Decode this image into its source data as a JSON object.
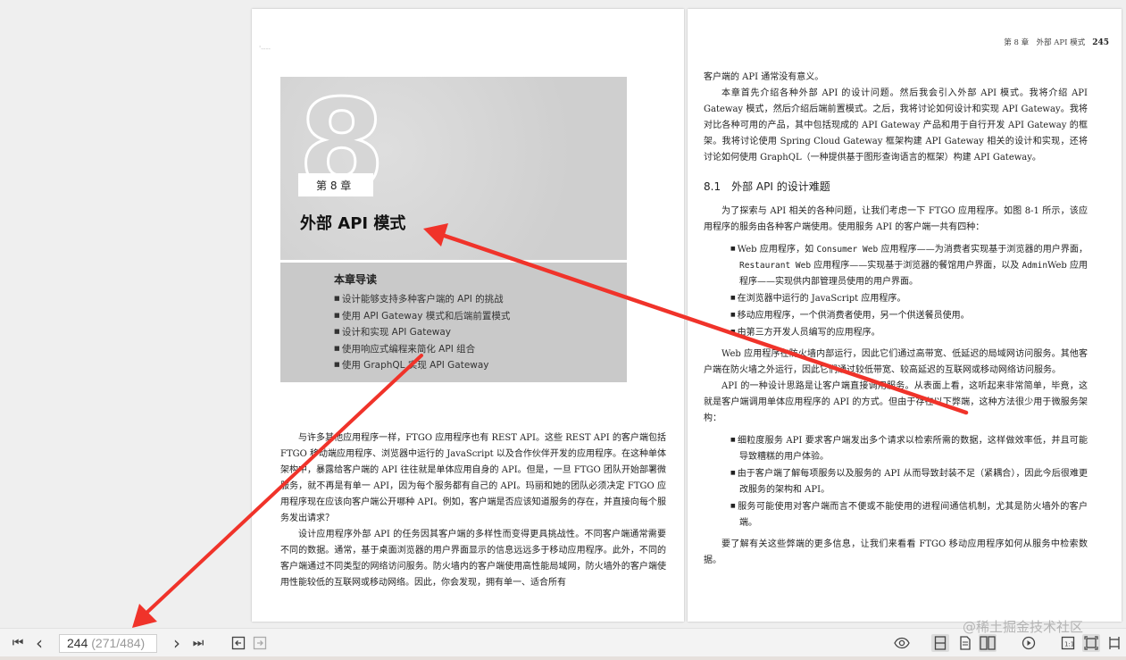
{
  "left_page": {
    "ghost_mark": "'----",
    "chapter_number": "8",
    "chapter_label": "第 8 章",
    "chapter_title": "外部 API 模式",
    "guide": {
      "title": "本章导读",
      "items": [
        "设计能够支持多种客户端的 API 的挑战",
        "使用 API Gateway 模式和后端前置模式",
        "设计和实现 API Gateway",
        "使用响应式编程来简化 API 组合",
        "使用 GraphQL 实现 API Gateway"
      ]
    },
    "paragraphs": [
      "与许多其他应用程序一样，FTGO 应用程序也有 REST API。这些 REST API 的客户端包括 FTGO 移动端应用程序、浏览器中运行的 JavaScript 以及合作伙伴开发的应用程序。在这种单体架构中，暴露给客户端的 API 往往就是单体应用自身的 API。但是，一旦 FTGO 团队开始部署微服务，就不再是有单一 API，因为每个服务都有自己的 API。玛丽和她的团队必须决定 FTGO 应用程序现在应该向客户端公开哪种 API。例如，客户端是否应该知道服务的存在，并直接向每个服务发出请求？",
      "设计应用程序外部 API 的任务因其客户端的多样性而变得更具挑战性。不同客户端通常需要不同的数据。通常，基于桌面浏览器的用户界面显示的信息远远多于移动应用程序。此外，不同的客户端通过不同类型的网络访问服务。防火墙内的客户端使用高性能局域网，防火墙外的客户端使用性能较低的互联网或移动网络。因此，你会发现，拥有单一、适合所有"
    ]
  },
  "right_page": {
    "running_head": "第 8 章　外部 API 模式",
    "page_number": "245",
    "intro": [
      "客户端的 API 通常没有意义。",
      "本章首先介绍各种外部 API 的设计问题。然后我会引入外部 API 模式。我将介绍 API Gateway 模式，然后介绍后端前置模式。之后，我将讨论如何设计和实现 API Gateway。我将对比各种可用的产品，其中包括现成的 API Gateway 产品和用于自行开发 API Gateway 的框架。我将讨论使用 Spring Cloud Gateway 框架构建 API Gateway 相关的设计和实现，还将讨论如何使用 GraphQL（一种提供基于图形查询语言的框架）构建 API Gateway。"
    ],
    "section_title": "8.1　外部 API 的设计难题",
    "section_intro": "为了探索与 API 相关的各种问题，让我们考虑一下 FTGO 应用程序。如图 8-1 所示，该应用程序的服务由各种客户端使用。使用服务 API 的客户端一共有四种：",
    "clients": {
      "web_a": "Web 应用程序，如 ",
      "consumer_web": "Consumer Web",
      "web_b": " 应用程序——为消费者实现基于浏览器的用户界面，",
      "restaurant_web": "Restaurant Web",
      "web_c": " 应用程序——实现基于浏览器的餐馆用户界面，以及 ",
      "admin": "Admin",
      "web_d": "Web 应用程序——实现供内部管理员使用的用户界面。",
      "js": "在浏览器中运行的 JavaScript 应用程序。",
      "mobile": "移动应用程序，一个供消费者使用，另一个供送餐员使用。",
      "third_party": "由第三方开发人员编写的应用程序。"
    },
    "para_firewall": "Web 应用程序在防火墙内部运行，因此它们通过高带宽、低延迟的局域网访问服务。其他客户端在防火墙之外运行，因此它们通过较低带宽、较高延迟的互联网或移动网络访问服务。",
    "para_design": "API 的一种设计思路是让客户端直接调用服务。从表面上看，这听起来非常简单，毕竟，这就是客户端调用单体应用程序的 API 的方式。但由于存在以下弊端，这种方法很少用于微服务架构：",
    "drawbacks": [
      "细粒度服务 API 要求客户端发出多个请求以检索所需的数据，这样做效率低，并且可能导致糟糕的用户体验。",
      "由于客户端了解每项服务以及服务的 API 从而导致封装不足（紧耦合），因此今后很难更改服务的架构和 API。",
      "服务可能使用对客户端而言不便或不能使用的进程间通信机制，尤其是防火墙外的客户端。"
    ],
    "para_closing": "要了解有关这些弊端的更多信息，让我们来看看 FTGO 移动应用程序如何从服务中检索数据。"
  },
  "toolbar": {
    "first_page": "⏮",
    "prev_page": "‹",
    "current_page": "244",
    "page_total": " (271/484)",
    "next_page": "›",
    "last_page": "⏭",
    "watermark": "@稀土掘金技术社区"
  },
  "colors": {
    "annotation_arrow": "#f0332a",
    "toolbar_bg": "#f3f3f3",
    "viewer_bg": "#efefef"
  }
}
